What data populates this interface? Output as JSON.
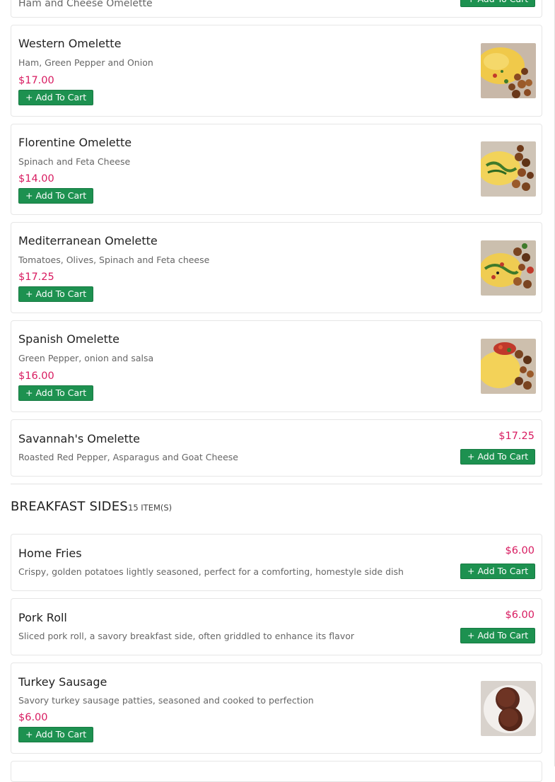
{
  "add_to_cart_label": "+ Add To Cart",
  "partial_top": {
    "name": "Ham and Cheese Omelette"
  },
  "omelettes": [
    {
      "name": "Western Omelette",
      "desc": "Ham, Green Pepper and Onion",
      "price": "$17.00",
      "image": "omelette-with-potatoes"
    },
    {
      "name": "Florentine Omelette",
      "desc": "Spinach and Feta Cheese",
      "price": "$14.00",
      "image": "spinach-omelette-with-potatoes"
    },
    {
      "name": "Mediterranean Omelette",
      "desc": "Tomatoes, Olives, Spinach and Feta cheese",
      "price": "$17.25",
      "image": "mediterranean-omelette-with-potatoes"
    },
    {
      "name": "Spanish Omelette",
      "desc": "Green Pepper, onion and salsa",
      "price": "$16.00",
      "image": "omelette-with-salsa-and-potatoes"
    },
    {
      "name": "Savannah's Omelette",
      "desc": "Roasted Red Pepper, Asparagus and Goat Cheese",
      "price": "$17.25"
    }
  ],
  "breakfast_sides": {
    "title": "BREAKFAST SIDES",
    "count": "15 ITEM(S)",
    "items": [
      {
        "name": "Home Fries",
        "desc": "Crispy, golden potatoes lightly seasoned, perfect for a comforting, homestyle side dish",
        "price": "$6.00"
      },
      {
        "name": "Pork Roll",
        "desc": "Sliced pork roll, a savory breakfast side, often griddled to enhance its flavor",
        "price": "$6.00"
      },
      {
        "name": "Turkey Sausage",
        "desc": "Savory turkey sausage patties, seasoned and cooked to perfection",
        "price": "$6.00",
        "image": "turkey-sausage-patties"
      }
    ]
  },
  "colors": {
    "price": "#d81b60",
    "button": "#1d9150",
    "border": "#e6e6e6"
  }
}
